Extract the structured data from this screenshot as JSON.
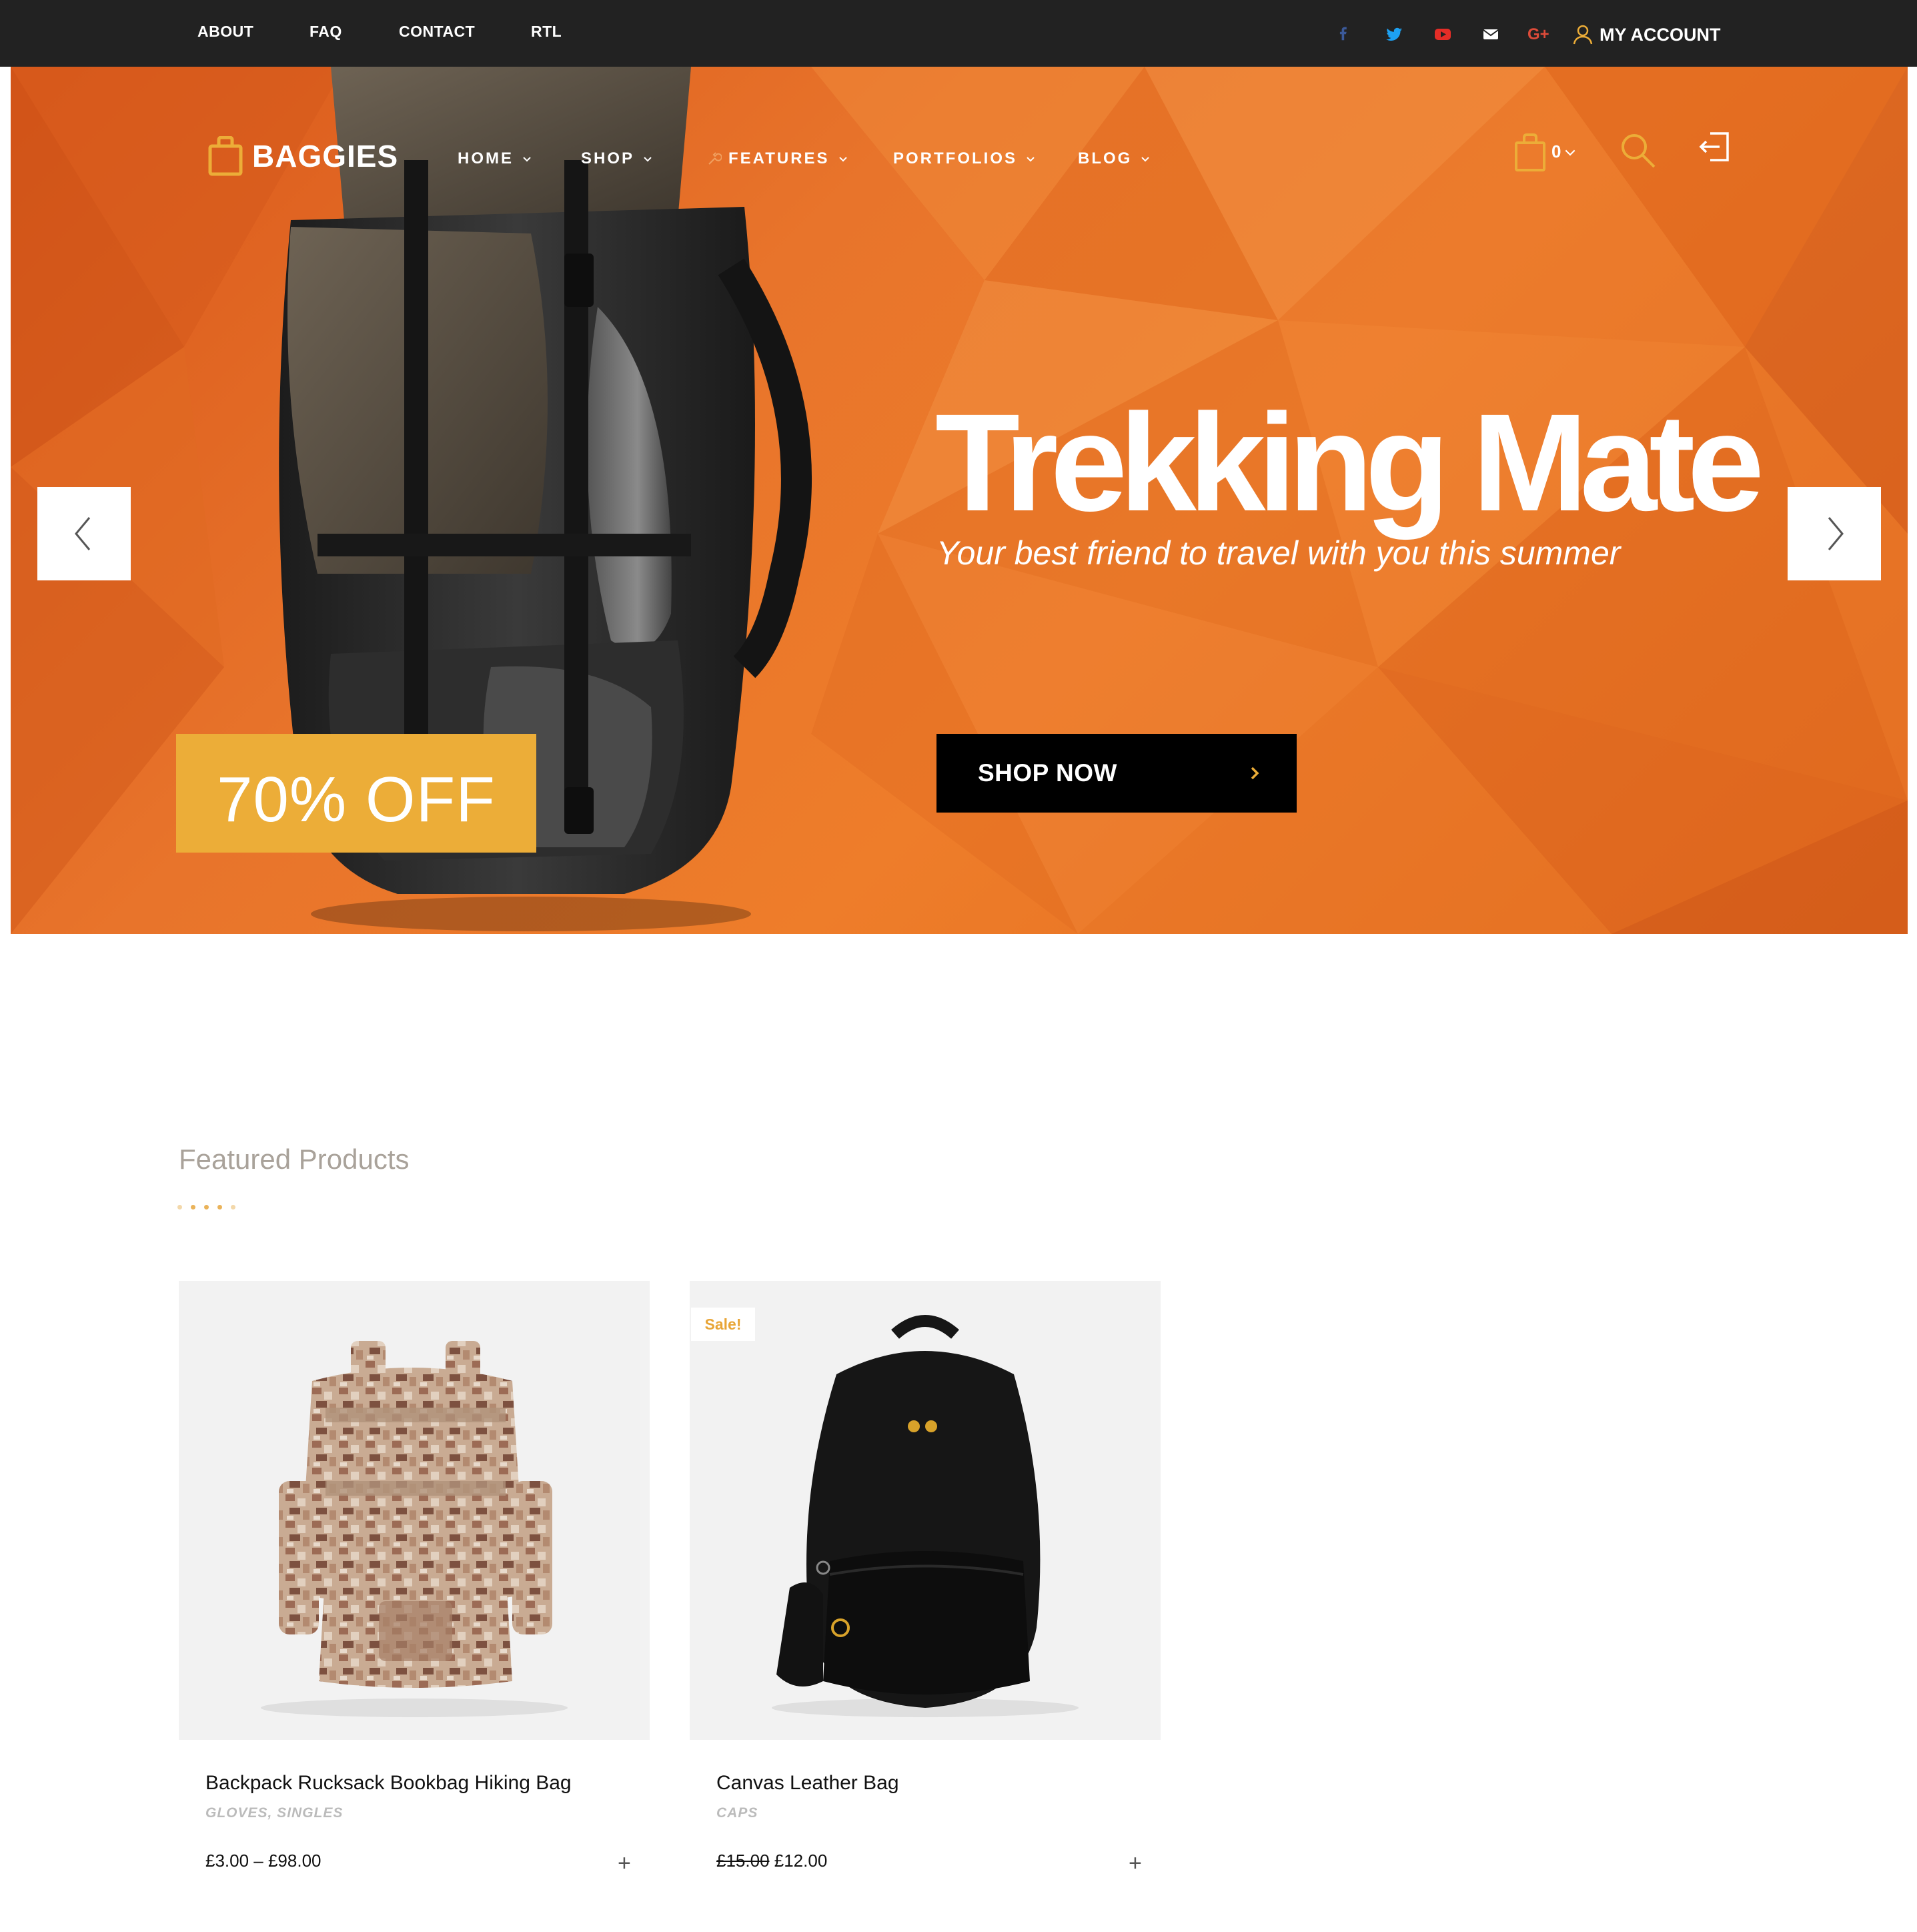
{
  "topbar": {
    "links": [
      "ABOUT",
      "FAQ",
      "CONTACT",
      "RTL"
    ],
    "social_icons": [
      "facebook-icon",
      "twitter-icon",
      "youtube-icon",
      "envelope-icon",
      "google-plus-icon"
    ],
    "account_label": "MY ACCOUNT"
  },
  "header": {
    "logo_text": "BAGGIES",
    "nav": [
      "HOME",
      "SHOP",
      "FEATURES",
      "PORTFOLIOS",
      "BLOG"
    ],
    "cart_count": "0",
    "icons": [
      "cart-icon",
      "search-icon",
      "login-icon"
    ]
  },
  "hero": {
    "title": "Trekking Mate",
    "subtitle": "Your best friend to travel with you this summer",
    "button_label": "SHOP NOW",
    "discount": "70% OFF"
  },
  "featured": {
    "title": "Featured Products",
    "products": [
      {
        "name": "Backpack Rucksack Bookbag Hiking Bag",
        "categories": "GLOVES, SINGLES",
        "price": "£3.00 – £98.00",
        "sale": false
      },
      {
        "name": "Canvas Leather Bag",
        "categories": "CAPS",
        "old_price": "£15.00",
        "price": "£12.00",
        "sale": true,
        "sale_label": "Sale!"
      }
    ]
  },
  "colors": {
    "topbar_bg": "#222222",
    "hero_orange": "#e8742b",
    "accent_yellow": "#ecad38",
    "facebook": "#3b5998",
    "twitter": "#1da1f2",
    "youtube": "#e52d27",
    "google_plus": "#dd4b39"
  }
}
